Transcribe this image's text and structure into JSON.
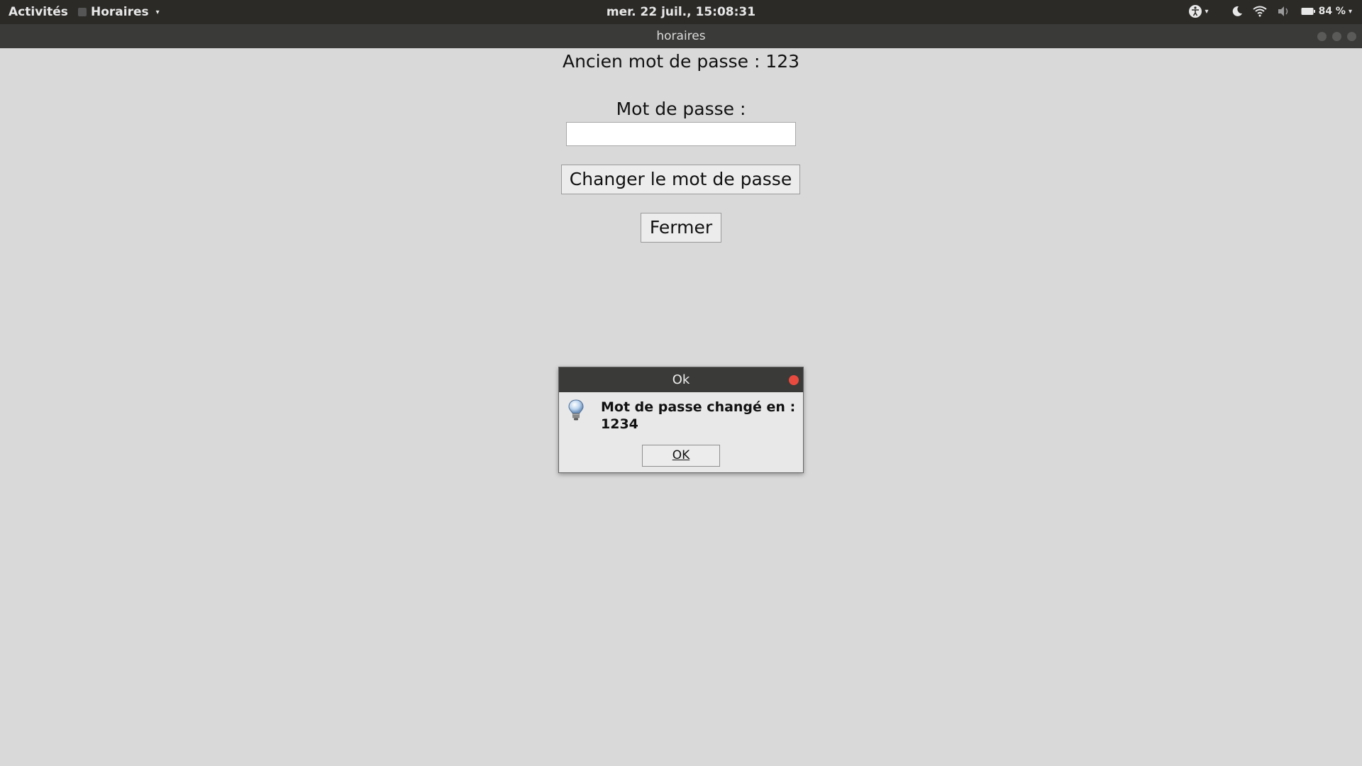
{
  "topbar": {
    "activities": "Activités",
    "app_menu": "Horaires",
    "clock": "mer. 22 juil., 15:08:31",
    "battery": "84 %",
    "icons": [
      "accessibility-icon",
      "night-light-icon",
      "wifi-icon",
      "volume-icon",
      "battery-icon"
    ]
  },
  "window": {
    "title": "horaires"
  },
  "main": {
    "old_password_text": "Ancien mot de passe : 123",
    "password_label": "Mot de passe :",
    "password_value": "",
    "change_button": "Changer le mot de passe",
    "close_button": "Fermer"
  },
  "dialog": {
    "title": "Ok",
    "message": "Mot de passe changé en : 1234",
    "ok_button": "OK",
    "icon": "lightbulb-icon"
  },
  "colors": {
    "background": "#d9d9d9",
    "topbar": "#2b2a27",
    "titlebar": "#3a3a38",
    "close_red": "#e94a3f"
  }
}
